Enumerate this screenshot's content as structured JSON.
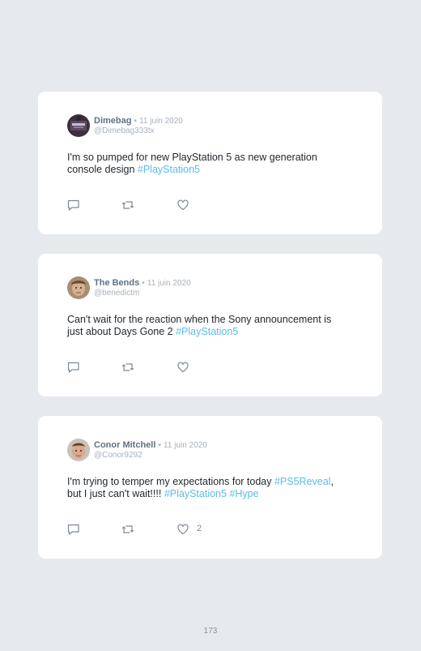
{
  "tweets": [
    {
      "name": "Dimebag",
      "separator": "•",
      "date": "11 juin 2020",
      "handle": "@Dimebag333tx",
      "text_line1": "I'm so pumped for new PlayStation 5 as new generation",
      "text_line2": "console design ",
      "hashtags": [
        "#PlayStation5"
      ],
      "likes": "",
      "avatar_icon": "avatar-dimebag"
    },
    {
      "name": "The Bends",
      "separator": "•",
      "date": "11 juin 2020",
      "handle": "@benedictm",
      "text_line1": "Can't wait for the reaction when the Sony announcement is",
      "text_line2": "just about Days Gone 2 ",
      "hashtags": [
        "#PlayStation5"
      ],
      "likes": "",
      "avatar_icon": "avatar-thebends"
    },
    {
      "name": "Conor Mitchell",
      "separator": "•",
      "date": "11 juin 2020",
      "handle": "@Conor9292",
      "text_line1a": "I'm trying to temper my expectations for today ",
      "text_line1_tag": "#PS5Reveal",
      "text_line1b": ",",
      "text_line2": "but I just can't wait!!!! ",
      "hashtags": [
        "#PlayStation5",
        "#Hype"
      ],
      "likes": "2",
      "avatar_icon": "avatar-conor"
    }
  ],
  "icons": {
    "reply": "comment-icon",
    "retweet": "retweet-icon",
    "like": "heart-icon"
  },
  "colors": {
    "background": "#e6e9ed",
    "card": "#ffffff",
    "name": "#5f7283",
    "meta": "#a7b1bb",
    "text": "#1f252b",
    "hashtag": "#5bbbe6",
    "icon": "#7d8994"
  },
  "page_number": "173"
}
